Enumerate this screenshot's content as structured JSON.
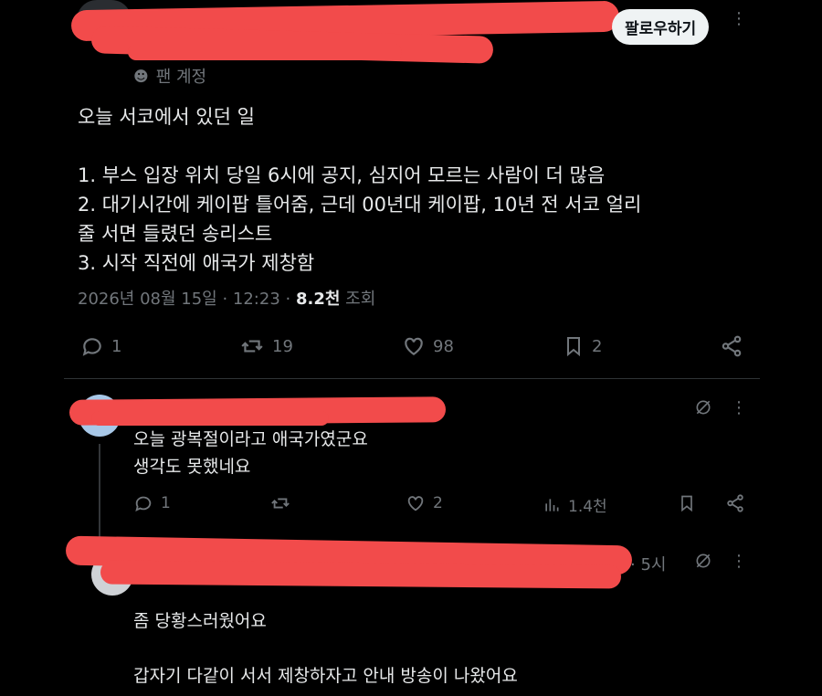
{
  "header": {
    "account_tag": "팬 계정",
    "follow_label": "팔로우하기"
  },
  "post": {
    "text": "오늘 서코에서 있던 일\n\n1. 부스 입장 위치 당일 6시에 공지, 심지어 모르는 사람이 더 많음\n2. 대기시간에 케이팝 틀어줌, 근데 00년대 케이팝, 10년 전 서코 얼리\n줄 서면 들렸던 송리스트\n3. 시작 직전에 애국가 제창함",
    "timestamp": "2026년 08월 15일 · 12:23 · ",
    "views_count": "8.2천",
    "views_label": " 조회",
    "actions": {
      "replies": "1",
      "reposts": "19",
      "likes": "98",
      "bookmarks": "2"
    }
  },
  "replies": [
    {
      "text": "오늘 광복절이라고 애국가였군요\n생각도 못했네요",
      "replies": "1",
      "reposts": "",
      "likes": "2",
      "views": "1.4천"
    },
    {
      "time": "· 5시",
      "text": "좀 당황스러웠어요\n\n갑자기 다같이 서서 제창하자고 안내 방송이 나왔어요"
    }
  ]
}
